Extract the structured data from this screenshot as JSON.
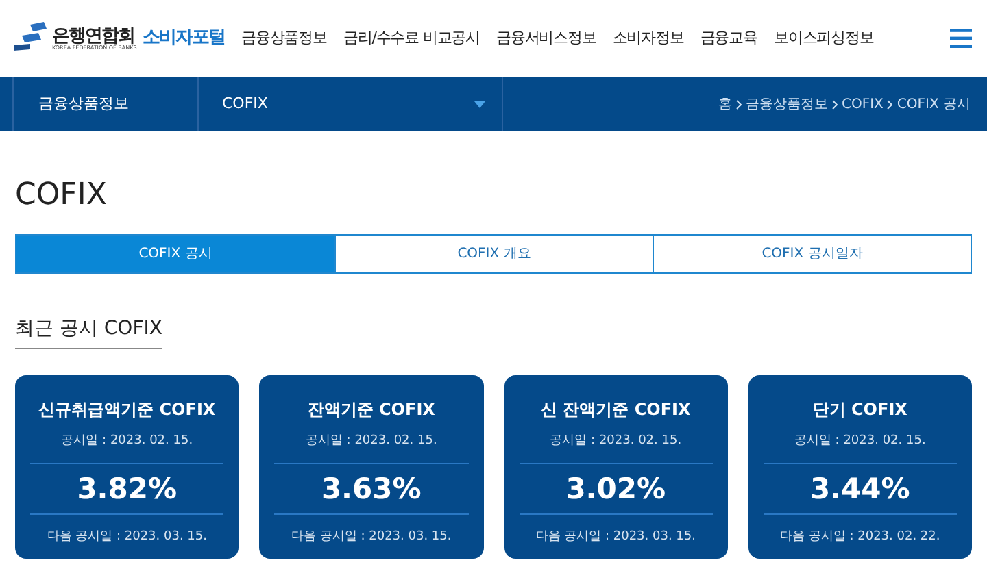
{
  "header": {
    "logo": {
      "name": "은행연합회",
      "sub": "KOREA FEDERATION OF BANKS",
      "portal": "소비자포털"
    },
    "nav": [
      "금융상품정보",
      "금리/수수료 비교공시",
      "금융서비스정보",
      "소비자정보",
      "금융교육",
      "보이스피싱정보"
    ]
  },
  "subnav": {
    "section": "금융상품정보",
    "dropdown": "COFIX",
    "breadcrumb": [
      "홈",
      "금융상품정보",
      "COFIX",
      "COFIX 공시"
    ]
  },
  "page_title": "COFIX",
  "tabs": [
    {
      "label": "COFIX 공시",
      "selected": true
    },
    {
      "label": "COFIX 개요",
      "selected": false
    },
    {
      "label": "COFIX 공시일자",
      "selected": false
    }
  ],
  "section_title": "최근 공시 COFIX",
  "cards": [
    {
      "title": "신규취급액기준 COFIX",
      "date": "공시일 : 2023. 02. 15.",
      "rate": "3.82%",
      "next": "다음 공시일 : 2023. 03. 15."
    },
    {
      "title": "잔액기준 COFIX",
      "date": "공시일 : 2023. 02. 15.",
      "rate": "3.63%",
      "next": "다음 공시일 : 2023. 03. 15."
    },
    {
      "title": "신 잔액기준 COFIX",
      "date": "공시일 : 2023. 02. 15.",
      "rate": "3.02%",
      "next": "다음 공시일 : 2023. 03. 15."
    },
    {
      "title": "단기 COFIX",
      "date": "공시일 : 2023. 02. 15.",
      "rate": "3.44%",
      "next": "다음 공시일 : 2023. 02. 22."
    }
  ]
}
